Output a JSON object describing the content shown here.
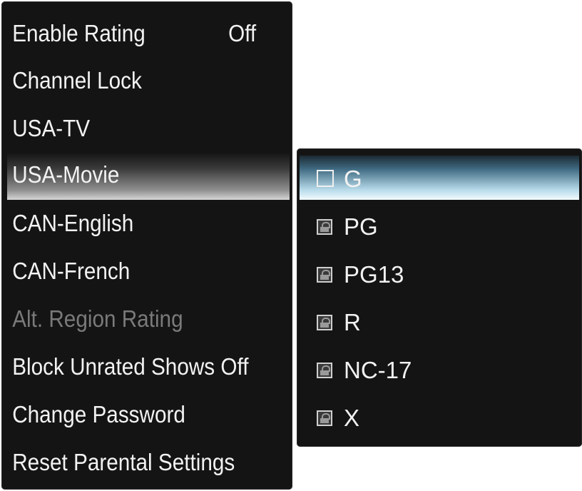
{
  "left_menu": {
    "items": [
      {
        "label": "Enable Rating",
        "value": "Off"
      },
      {
        "label": "Channel Lock",
        "value": ""
      },
      {
        "label": "USA-TV",
        "value": ""
      },
      {
        "label": "USA-Movie",
        "value": ""
      },
      {
        "label": "CAN-English",
        "value": ""
      },
      {
        "label": "CAN-French",
        "value": ""
      },
      {
        "label": "Alt. Region Rating",
        "value": ""
      },
      {
        "label": "Block Unrated Shows Off",
        "value": ""
      },
      {
        "label": "Change Password",
        "value": ""
      },
      {
        "label": "Reset Parental Settings",
        "value": ""
      }
    ],
    "selected_index": 3,
    "disabled_index": 6
  },
  "rating_menu": {
    "items": [
      {
        "label": "G",
        "icon": "empty-checkbox-icon"
      },
      {
        "label": "PG",
        "icon": "lock-icon"
      },
      {
        "label": "PG13",
        "icon": "lock-icon"
      },
      {
        "label": "R",
        "icon": "lock-icon"
      },
      {
        "label": "NC-17",
        "icon": "lock-icon"
      },
      {
        "label": "X",
        "icon": "lock-icon"
      }
    ],
    "selected_index": 0
  },
  "colors": {
    "panel_bg": "#141414",
    "text": "#f2f2f2",
    "disabled_text": "#7a7a7a",
    "rating_highlight": "#b9dceb"
  }
}
